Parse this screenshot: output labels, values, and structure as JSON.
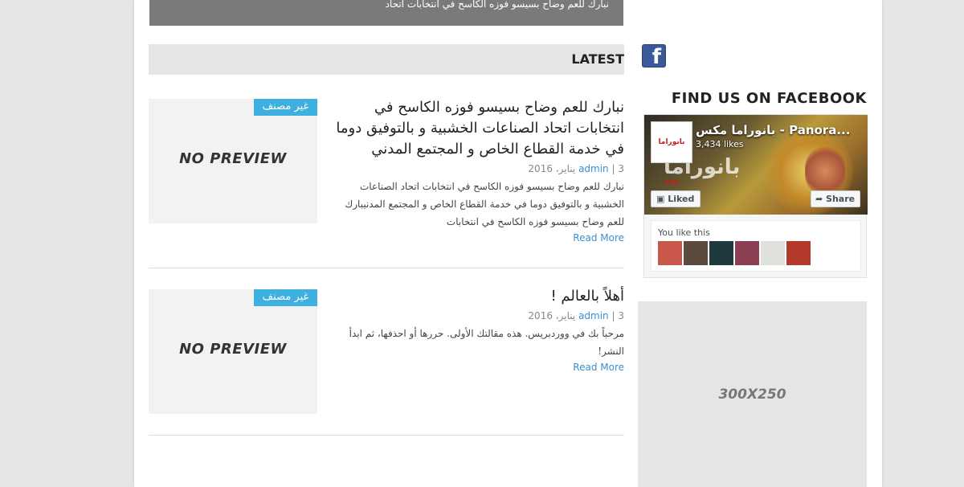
{
  "banner": {
    "caption": "نبارك للعم وضاح بسيسو فوزه الكاسح في انتخابات اتحاد"
  },
  "latest": {
    "heading": "LATEST"
  },
  "posts": [
    {
      "category": "غير مصنف",
      "thumb_text": "NO PREVIEW",
      "title": "نبارك للعم وضاح بسيسو فوزه الكاسح في انتخابات اتحاد الصناعات الخشبية و بالتوفيق دوما في خدمة القطاع الخاص و المجتمع المدني",
      "day": "3",
      "author": "admin",
      "date": "يناير، 2016",
      "excerpt": "نبارك للعم وضاح بسيسو فوزه الكاسح في انتخابات اتحاد الصناعات الخشبية و بالتوفيق دوما في خدمة القطاع الخاص و المجتمع المدنيبارك للعم وضاح بسيسو فوزه الكاسح في انتخابات",
      "read_more": "Read More"
    },
    {
      "category": "غير مصنف",
      "thumb_text": "NO PREVIEW",
      "title": "أهلاً بالعالم !",
      "day": "3",
      "author": "admin",
      "date": "يناير، 2016",
      "excerpt": "مرحباً بك في ووردبريس. هذه مقالتك الأولى. حررها أو احذفها، ثم ابدأ النشر!",
      "read_more": "Read More"
    }
  ],
  "sidebar": {
    "facebook_icon": "facebook-icon",
    "facebook_heading": "FIND US ON FACEBOOK",
    "fb_page": {
      "logo_text": "بانوراما mix",
      "name": "بانوراما مكس - Panora...",
      "likes": "3,434 likes",
      "cover_text": "بانوراما",
      "liked_label": "Liked",
      "share_label": "Share",
      "you_like_this": "You like this",
      "friend_colors": [
        "#c9564a",
        "#5b4a3e",
        "#1f3a3f",
        "#8c3f52",
        "#dfe2dc",
        "#b33a2a"
      ]
    },
    "ad_label": "300X250"
  },
  "colors": {
    "category_badge": "#3eb0e0",
    "link": "#3a8fd0",
    "facebook_blue": "#3b5998"
  }
}
